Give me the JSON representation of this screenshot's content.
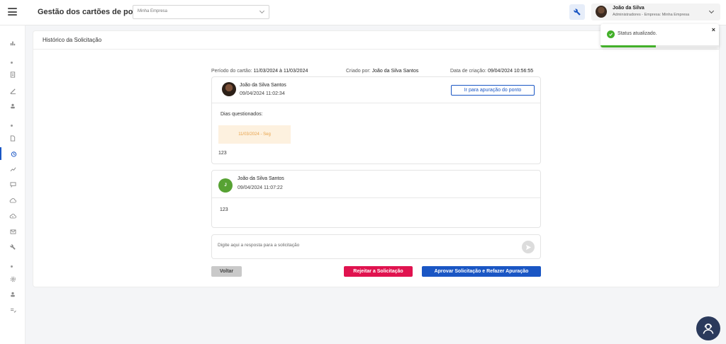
{
  "header": {
    "app_title": "Gestão dos cartões de ponto",
    "company_select_value": "Minha Empresa"
  },
  "user": {
    "name": "João da Silva",
    "role": "Administradores - Empresa: Minha Empresa"
  },
  "panel": {
    "title": "Histórico da Solicitação"
  },
  "meta": {
    "period_label": "Período do cartão:",
    "period_value": "11/03/2024 à 11/03/2024",
    "created_by_label": "Criado por:",
    "created_by_value": "João da Silva Santos",
    "created_date_label": "Data de criação:",
    "created_date_value": "09/04/2024 10:56:55"
  },
  "messages": [
    {
      "author": "João da Silva Santos",
      "datetime": "09/04/2024 11:02:34",
      "link_label": "Ir para apuração do ponto",
      "days_label": "Dias questionados:",
      "day_chip": "11/03/2024 - Seg",
      "text": "123"
    },
    {
      "author": "João da Silva Santos",
      "datetime": "09/04/2024 11:07:22",
      "avatar_letter": "J",
      "text": "123"
    }
  ],
  "reply": {
    "placeholder": "Digite aqui a resposta para a solicitação"
  },
  "actions": {
    "back_label": "Voltar",
    "reject_label": "Rejeitar a Solicitação",
    "approve_label": "Aprovar Solicitação e Refazer Apuração"
  },
  "toast": {
    "message": "Status atualizado.",
    "close_label": "×",
    "progress": 0.47
  },
  "colors": {
    "primary": "#1a56c4",
    "danger": "#e0134f",
    "success": "#43b02a",
    "chip_bg": "#fdf1df",
    "chip_text": "#e8a24a"
  },
  "sidebar": {
    "items": [
      "chart-icon",
      "document-icon",
      "pen-icon",
      "user-icon",
      "file-icon",
      "alarm-clock-icon",
      "trend-icon",
      "chat-icon",
      "cloud-icon",
      "cloud-upload-icon",
      "mail-icon",
      "wrench-icon",
      "settings-icon",
      "user-settings-icon",
      "list-icon"
    ],
    "active_item": "alarm-clock-icon"
  }
}
